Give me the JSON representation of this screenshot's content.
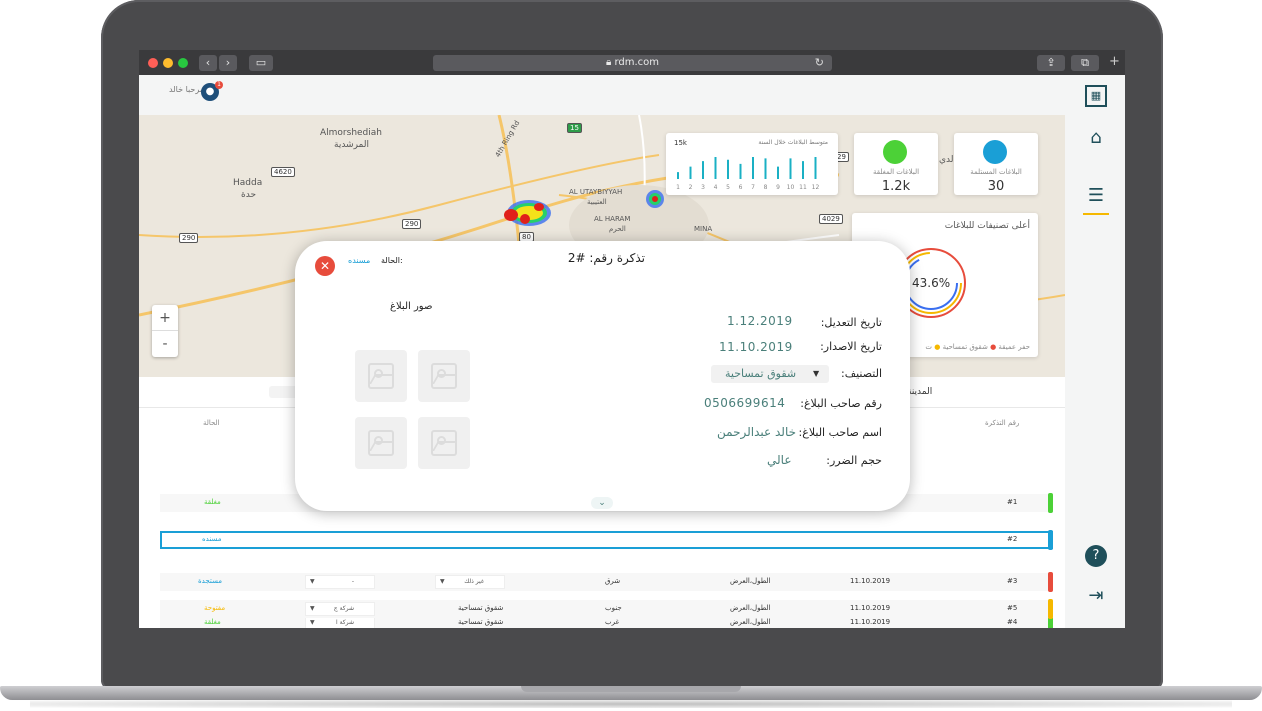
{
  "browser": {
    "url": "rdm.com"
  },
  "user": {
    "name": "مرحبا خالد",
    "notifications": "1"
  },
  "map": {
    "labels": {
      "almorshediah_en": "Almorshediah",
      "almorshediah_ar": "المرشدية",
      "hadda_en": "Hadda",
      "hadda_ar": "حدة",
      "utaybiyyah_en": "AL UTAYBIYYAH",
      "utaybiyyah_ar": "العتيبية",
      "haram_en": "AL HARAM",
      "haram_ar": "الحرم",
      "mina": "MINA",
      "ring_road": "4th Ring Rd",
      "partial_ar": "الدي"
    },
    "shields": [
      "4620",
      "290",
      "290",
      "15",
      "80",
      "4029",
      "29"
    ],
    "zoom_in": "+",
    "zoom_out": "-"
  },
  "stats": {
    "open": {
      "label": "البلاغات المستلمة",
      "value": "30",
      "color": "#1a9fd6"
    },
    "closed": {
      "label": "البلاغات المغلقة",
      "value": "1.2k",
      "color": "#4cd137"
    }
  },
  "mini_chart": {
    "title": "متوسط البلاغات خلال السنة",
    "max_label": "15k",
    "months": [
      "1",
      "2",
      "3",
      "4",
      "5",
      "6",
      "7",
      "8",
      "9",
      "10",
      "11",
      "12"
    ],
    "values": [
      5,
      9,
      13,
      16,
      14,
      11,
      16,
      15,
      9,
      15,
      13,
      16
    ],
    "color": "#1ab0c4"
  },
  "donut": {
    "title": "أعلى تصنيفات للبلاغات",
    "value": "43.6%",
    "legend": [
      "حفر عميقة",
      "شقوق تمساحية",
      "ت"
    ],
    "legend_colors": [
      "#e74c3c",
      "#f5b800",
      "#999999"
    ]
  },
  "modal": {
    "title_label": "تذكرة رقم:",
    "title_value": "#2",
    "status_label": "الحالة:",
    "status_value": "مسنده",
    "modified_label": "تاريخ التعديل:",
    "modified_value": "1.12.2019",
    "issued_label": "تاريخ الاصدار:",
    "issued_value": "11.10.2019",
    "category_label": "التصنيف:",
    "category_value": "شقوق تمساحية",
    "phone_label": "رقم صاحب البلاغ:",
    "phone_value": "0506699614",
    "reporter_label": "اسم صاحب البلاغ:",
    "reporter_value": "خالد عبدالرحمن",
    "damage_label": "حجم الضرر:",
    "damage_value": "عالي",
    "photos_title": "صور البلاغ"
  },
  "table": {
    "tab_label": "المدينة",
    "headers": {
      "ticket": "رقم التذكرة",
      "status": "الحالة"
    },
    "rows": [
      {
        "id": "#1",
        "status": "مغلقة",
        "status_color": "#4cd137",
        "bar": "#4cd137"
      },
      {
        "id": "#2",
        "status": "مسنده",
        "status_color": "#1a9fd6",
        "bar": "#1a9fd6"
      },
      {
        "id": "#3",
        "date": "11.10.2019",
        "road": "الطول،العرض",
        "dir": "شرق",
        "cat": "غير ذلك",
        "team": "-",
        "status": "مستجدة",
        "status_color": "#1a9fd6",
        "bar": "#e74c3c"
      },
      {
        "id": "#4",
        "date": "11.10.2019",
        "road": "الطول،العرض",
        "dir": "غرب",
        "cat": "شقوق تمساحية",
        "team": "شركة ا",
        "status": "مغلقة",
        "status_color": "#4cd137",
        "bar": "#4cd137"
      },
      {
        "id": "#5",
        "date": "11.10.2019",
        "road": "الطول،العرض",
        "dir": "جنوب",
        "cat": "شقوق تمساحية",
        "team": "شركة ج",
        "status": "مفتوحة",
        "status_color": "#f5b800",
        "bar": "#f5b800"
      }
    ]
  },
  "icons": {
    "logo": "grid-logo-icon",
    "home": "home-icon",
    "menu": "menu-icon",
    "help": "help-icon",
    "logout": "logout-icon"
  }
}
